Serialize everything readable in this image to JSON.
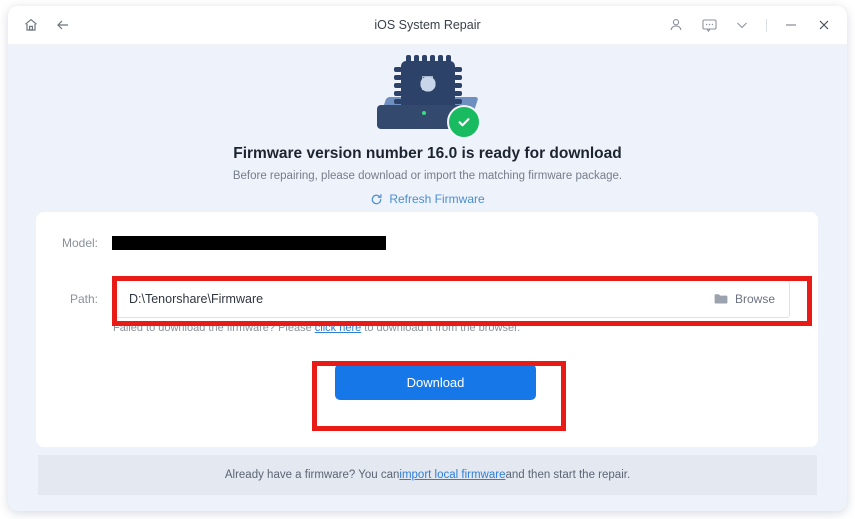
{
  "window": {
    "title": "iOS System Repair",
    "titlebar_icons": {
      "home": "home-icon",
      "back": "back-arrow-icon",
      "account": "person-icon",
      "feedback": "chat-bubble-icon",
      "more": "chevron-down-icon",
      "minimize": "minimize-icon",
      "close": "close-icon"
    }
  },
  "hero": {
    "title": "Firmware version number 16.0 is ready for download",
    "subtitle": "Before repairing, please download or import the matching firmware package.",
    "refresh_label": "Refresh Firmware",
    "refresh_icon": "refresh-icon",
    "illustration_icon": "chip-with-apple-logo-icon",
    "status_icon": "green-check-circle-icon"
  },
  "form": {
    "model_label": "Model:",
    "model_value": "",
    "model_redacted": true,
    "path_label": "Path:",
    "path_value": "D:\\Tenorshare\\Firmware",
    "browse_label": "Browse",
    "browse_icon": "folder-icon",
    "hint_prefix": "Failed to download the firmware? Please ",
    "hint_link": "click here",
    "hint_suffix": " to download it from the browser.",
    "download_label": "Download"
  },
  "footer": {
    "prefix": "Already have a firmware? You can ",
    "link": "import local firmware",
    "suffix": " and then start the repair."
  },
  "colors": {
    "accent_blue": "#1678e8",
    "link_blue": "#2f7fd6",
    "annotation_red": "#e81b16",
    "success_green": "#18bb5f",
    "body_bg": "#eef2fa",
    "footer_bg": "#e3e8f1"
  }
}
